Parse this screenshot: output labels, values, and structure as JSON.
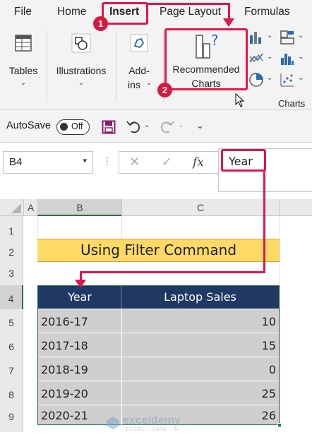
{
  "ribbon": {
    "tabs": [
      "File",
      "Home",
      "Insert",
      "Page Layout",
      "Formulas"
    ],
    "active_tab": "Insert",
    "groups": {
      "tables_label": "Tables",
      "illustrations_label": "Illustrations",
      "addins_label_line1": "Add-",
      "addins_label_line2": "ins",
      "recommended_charts_line1": "Recommended",
      "recommended_charts_line2": "Charts",
      "charts_group_label": "Charts"
    }
  },
  "qat": {
    "autosave_label": "AutoSave",
    "toggle_state": "Off"
  },
  "formula_bar": {
    "name_box": "B4",
    "fx_label": "fx",
    "formula_content": "Year"
  },
  "grid": {
    "columns": [
      "A",
      "B",
      "C"
    ],
    "rows": [
      "1",
      "2",
      "3",
      "4",
      "5",
      "6",
      "7",
      "8",
      "9"
    ]
  },
  "sheet": {
    "title": "Using Filter Command",
    "headers": [
      "Year",
      "Laptop Sales"
    ],
    "rows": [
      {
        "year": "2016-17",
        "sales": "10"
      },
      {
        "year": "2017-18",
        "sales": "15"
      },
      {
        "year": "2018-19",
        "sales": "0"
      },
      {
        "year": "2019-20",
        "sales": "25"
      },
      {
        "year": "2020-21",
        "sales": "26"
      }
    ]
  },
  "annotations": {
    "step1": "1",
    "step2": "2"
  },
  "watermark": {
    "brand": "exceldemy",
    "tagline": "EXCEL · DATA · BI"
  },
  "colors": {
    "header_fill": "#1f3864",
    "title_fill": "#ffd966",
    "data_fill": "#d0cece",
    "annotation_red": "#e0174a",
    "excel_green": "#217346"
  }
}
